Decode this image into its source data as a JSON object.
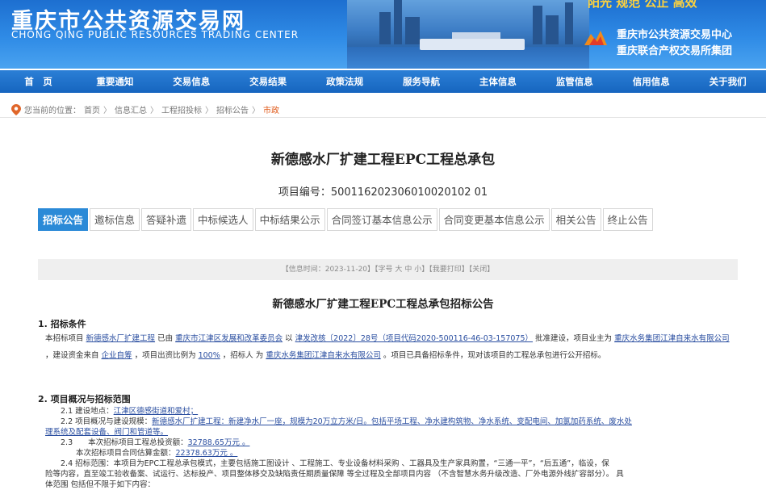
{
  "header": {
    "site_title": "重庆市公共资源交易网",
    "site_subtitle": "CHONG QING PUBLIC RESOURCES TRADING CENTER",
    "slogan": "阳光  规范  公正  高效",
    "org_line1": "重庆市公共资源交易中心",
    "org_line2": "重庆联合产权交易所集团"
  },
  "nav": [
    "首　页",
    "重要通知",
    "交易信息",
    "交易结果",
    "政策法规",
    "服务导航",
    "主体信息",
    "监管信息",
    "信用信息",
    "关于我们"
  ],
  "breadcrumb": {
    "prefix": "您当前的位置：",
    "items": [
      "首页",
      "信息汇总",
      "工程招投标",
      "招标公告"
    ],
    "current": "市政"
  },
  "project": {
    "title": "新德感水厂扩建工程EPC工程总承包",
    "code": "项目编号：500116202306010020102 01"
  },
  "tabs": [
    "招标公告",
    "邀标信息",
    "答疑补遗",
    "中标候选人",
    "中标结果公示",
    "合同签订基本信息公示",
    "合同变更基本信息公示",
    "相关公告",
    "终止公告"
  ],
  "meta": {
    "time": "【信息时间：2023-11-20】",
    "font_prefix": "【字号",
    "font_big": "大",
    "font_mid": "中",
    "font_small": "小",
    "font_suffix": "】",
    "print": "【我要打印】",
    "close": "【关闭】"
  },
  "announcement": {
    "title": "新德感水厂扩建工程EPC工程总承包招标公告",
    "s1_title": "1. 招标条件",
    "s1_text1": "本招标项目 ",
    "s1_u1": "新德感水厂扩建工程",
    "s1_text2": " 已由 ",
    "s1_u2": "重庆市江津区发展和改革委员会",
    "s1_text3": " 以 ",
    "s1_u3": "津发改核〔2022〕28号（项目代码2020-500116-46-03-157075）",
    "s1_text4": " 批准建设，项目业主为 ",
    "s1_u4": "重庆水务集团江津自来水有限公司",
    "s1_text5": " ，建设资金来自 ",
    "s1_u5": "企业自筹",
    "s1_text6": " ，项目出资比例为 ",
    "s1_u6": "100%",
    "s1_text7": " ，招标人 为 ",
    "s1_u7": "重庆水务集团江津自来水有限公司",
    "s1_text8": " 。项目已具备招标条件，现对该项目的工程总承包进行公开招标。",
    "s2_title": "2. 项目概况与招标范围",
    "l1_pre": "　　2.1 建设地点：",
    "l1_u": "江津区德感街道和爱村；",
    "l2_pre": "　　2.2 项目概况与建设规模：",
    "l2_u": "新德感水厂扩建工程：新建净水厂一座，规模为20万立方米/日。包括平场工程、净水建构筑物、净水系统、变配电间、加氯加药系统、废水处",
    "l3_u": "理系统及配套设备、阀门和管道等。",
    "l4_pre": "　　2.3　　本次招标项目工程总投资额：",
    "l4_u": "32788.65万元 。",
    "l5_pre": "　　　　本次招标项目合同估算金额：",
    "l5_u": "22378.63万元 。",
    "l6": "　　2.4 招标范围：本项目为EPC工程总承包模式，主要包括施工图设计 、工程施工、专业设备材料采购 、工器具及生产家具购置，“三通一平”，“后五通”，临设，保",
    "l7": "险等内容，直至竣工验收备案、试运行、达标投产、项目整体移交及缺陷责任期质量保障 等全过程及全部项目内容 （不含智慧水务升级改造、厂外电源外线扩容部分）。 具",
    "l8": "体范围 包括但不限于如下内容："
  }
}
